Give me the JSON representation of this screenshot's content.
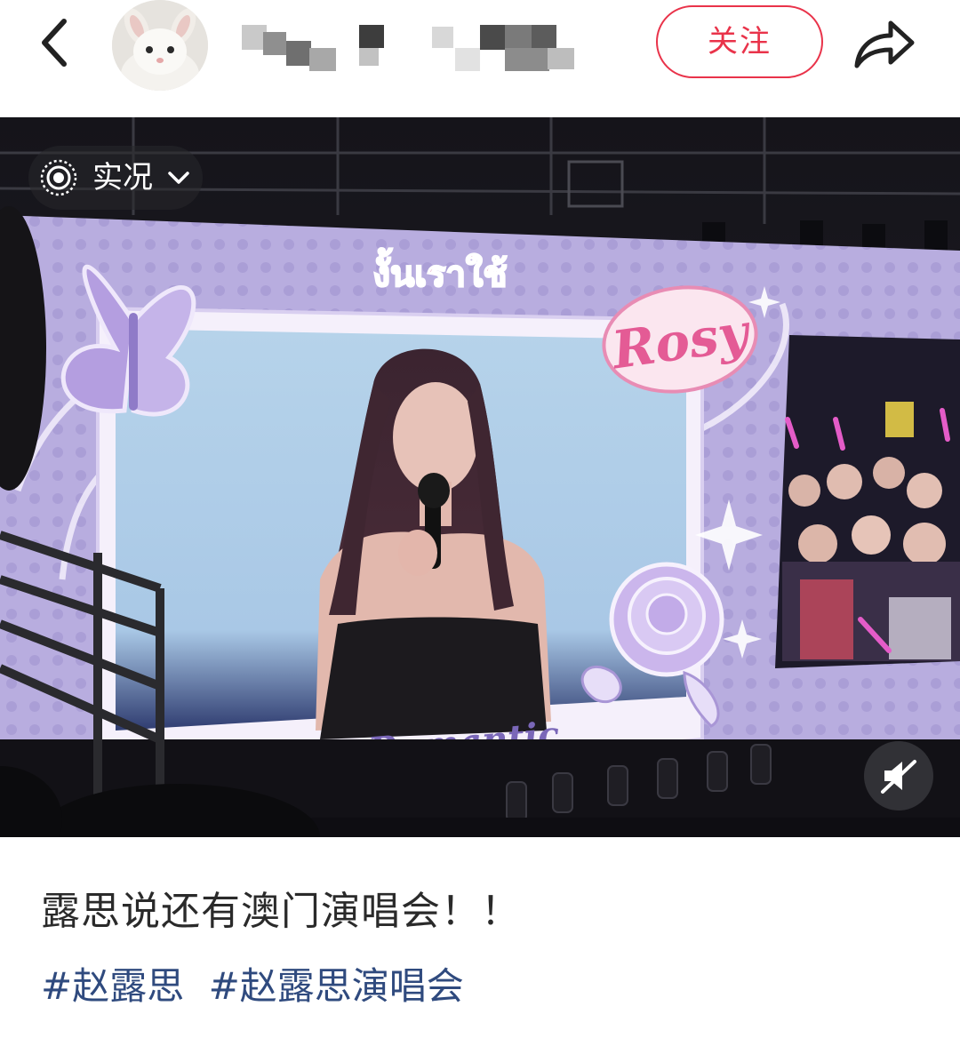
{
  "header": {
    "back_icon": "chevron-left-icon",
    "avatar_description": "white rabbit avatar",
    "username": "",
    "follow_label": "关注",
    "share_icon": "share-arrow-icon",
    "accent_color": "#e9334a"
  },
  "media": {
    "live_badge": {
      "icon": "live-photo-icon",
      "label": "实况",
      "dropdown_icon": "chevron-down-icon"
    },
    "screen_texts": {
      "thai_title": "งั้นเราใช้",
      "rosy": "Rosy",
      "tagline": "Stay  Romantic"
    },
    "mute_icon": "speaker-muted-icon"
  },
  "post": {
    "caption": "露思说还有澳门演唱会！！",
    "tags": [
      "#赵露思",
      "#赵露思演唱会"
    ],
    "tag_color": "#2f4a7e"
  }
}
